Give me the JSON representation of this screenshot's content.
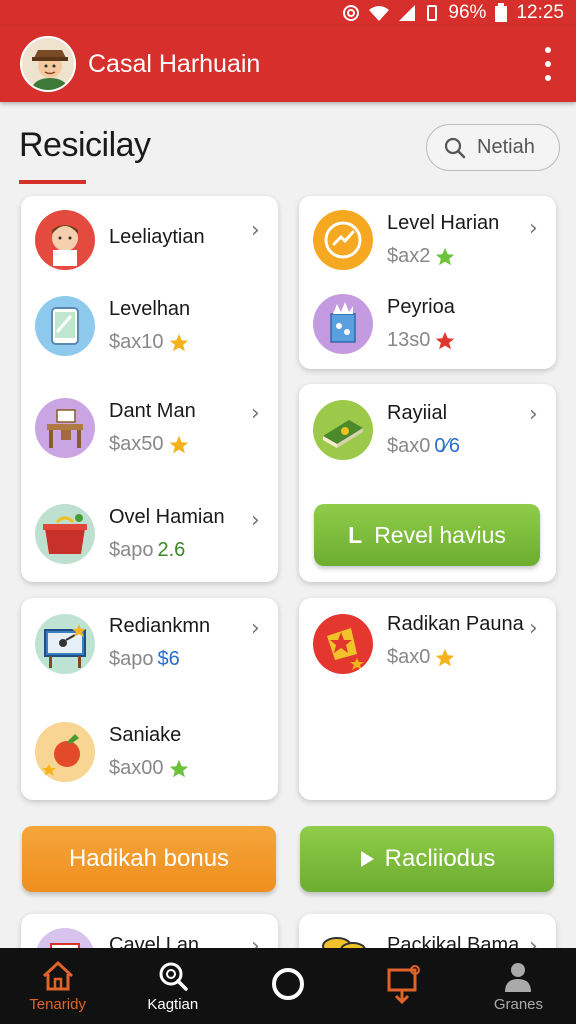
{
  "status_bar": {
    "battery": "96%",
    "time": "12:25"
  },
  "app_bar": {
    "title": "Casal Harhuain"
  },
  "page": {
    "title": "Resicilay"
  },
  "search": {
    "label": "Netiah"
  },
  "left_card_1": {
    "items": [
      {
        "name": "Leeliaytian",
        "price": ""
      },
      {
        "name": "Levelhan",
        "price": "$ax10"
      },
      {
        "name": "Dant Man",
        "price": "$ax50"
      },
      {
        "name": "Ovel Hamian",
        "price": "$apo",
        "accent": "2.6"
      }
    ]
  },
  "right_card_1": {
    "items": [
      {
        "name": "Level Harian",
        "price": "$ax2"
      },
      {
        "name": "Peyrioa",
        "price": "13s0"
      }
    ]
  },
  "right_card_2": {
    "items": [
      {
        "name": "Rayiial",
        "price": "$ax0",
        "accent": "0⁄6"
      }
    ],
    "button": "Revel havius"
  },
  "left_card_2": {
    "items": [
      {
        "name": "Rediankmn",
        "price": "$apo",
        "accent": "$6"
      },
      {
        "name": "Saniake",
        "price": "$ax00"
      }
    ]
  },
  "right_card_3": {
    "items": [
      {
        "name": "Radikan Pauna",
        "price": "$ax0"
      }
    ]
  },
  "buttons": {
    "bonus": "Hadikah bonus",
    "play": "Racliiodus"
  },
  "peek": {
    "left": "Cavel Lan",
    "right": "Packikal Bama"
  },
  "nav": [
    {
      "label": "Tenaridy"
    },
    {
      "label": "Kagtian"
    },
    {
      "label": ""
    },
    {
      "label": ""
    },
    {
      "label": "Granes"
    }
  ],
  "colors": {
    "brand_red": "#d62f2c",
    "accent_green": "#7bbd3a",
    "accent_orange": "#f29a2a",
    "nav_active": "#e0632a"
  }
}
